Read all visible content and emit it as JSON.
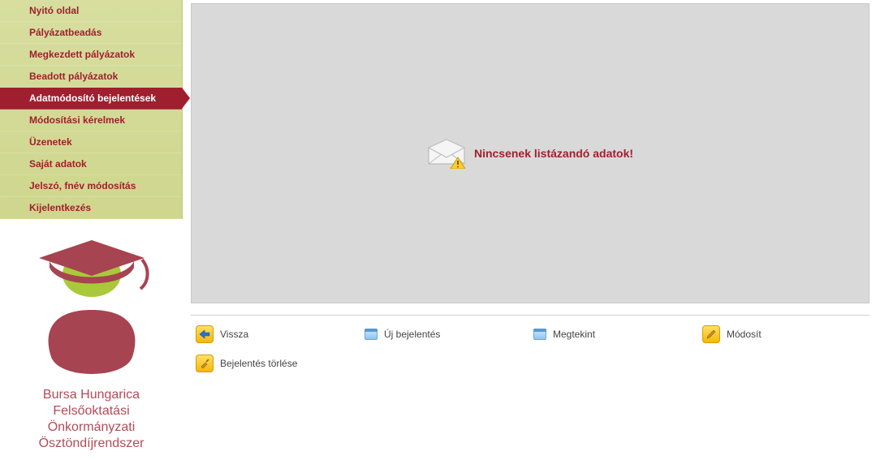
{
  "sidebar": {
    "items": [
      {
        "label": "Nyitó oldal",
        "active": false
      },
      {
        "label": "Pályázatbeadás",
        "active": false
      },
      {
        "label": "Megkezdett pályázatok",
        "active": false
      },
      {
        "label": "Beadott pályázatok",
        "active": false
      },
      {
        "label": "Adatmódosító bejelentések",
        "active": true
      },
      {
        "label": "Módosítási kérelmek",
        "active": false
      },
      {
        "label": "Üzenetek",
        "active": false
      },
      {
        "label": "Saját adatok",
        "active": false
      },
      {
        "label": "Jelszó, fnév módosítás",
        "active": false
      },
      {
        "label": "Kijelentkezés",
        "active": false
      }
    ]
  },
  "logo": {
    "line1": "Bursa Hungarica",
    "line2": "Felsőoktatási Önkormányzati",
    "line3": "Ösztöndíjrendszer"
  },
  "panel": {
    "empty_message": "Nincsenek listázandó adatok!"
  },
  "toolbar": {
    "back_label": "Vissza",
    "new_label": "Új bejelentés",
    "view_label": "Megtekint",
    "edit_label": "Módosít",
    "delete_label": "Bejelentés törlése"
  },
  "colors": {
    "accent": "#a01f2f",
    "menu_bg": "#d2d98f",
    "panel_bg": "#d9d9d9"
  }
}
